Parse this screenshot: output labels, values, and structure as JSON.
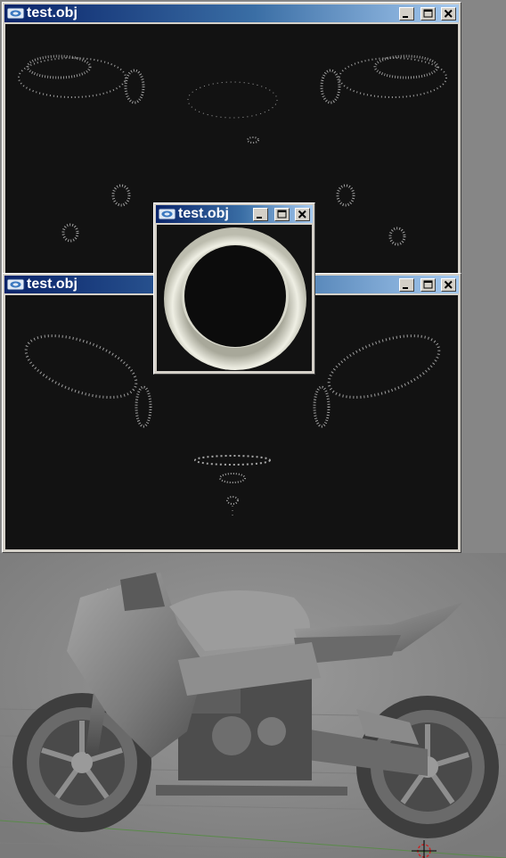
{
  "windows": {
    "top": {
      "title": "test.obj"
    },
    "bottom": {
      "title": "test.obj"
    },
    "popup": {
      "title": "test.obj"
    }
  },
  "icons": {
    "app": "app-icon",
    "minimize": "minimize-icon",
    "maximize": "maximize-icon",
    "close": "close-icon"
  },
  "colors": {
    "titlebar_start": "#0a246a",
    "titlebar_end": "#a6caf0",
    "window_face": "#d4d0c8",
    "client_bg": "#121212",
    "viewport_bg": "#8a8a8a",
    "grid_line": "#5a8a4a",
    "cursor": "#cc2222"
  },
  "viewport": {
    "model": "motorcycle-model",
    "cursor": "3d-cursor"
  }
}
